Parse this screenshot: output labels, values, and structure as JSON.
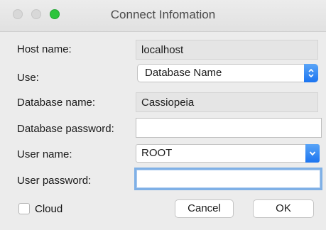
{
  "window": {
    "title": "Connect Infomation"
  },
  "form": {
    "host_label": "Host name:",
    "host_value": "localhost",
    "use_label": "Use:",
    "use_value": "Database Name",
    "dbname_label": "Database name:",
    "dbname_value": "Cassiopeia",
    "dbpass_label": "Database password:",
    "dbpass_value": "",
    "user_label": "User name:",
    "user_value": "ROOT",
    "userpass_label": "User password:",
    "userpass_value": ""
  },
  "footer": {
    "cloud_label": "Cloud",
    "cloud_checked": false,
    "cancel_label": "Cancel",
    "ok_label": "OK"
  },
  "icons": {
    "use_select": "updown-chevron-icon",
    "user_combo": "chevron-down-icon"
  },
  "colors": {
    "zoom_button": "#2dc43d",
    "accent": "#1b74f0",
    "focus_ring": "#7fb0e6"
  }
}
